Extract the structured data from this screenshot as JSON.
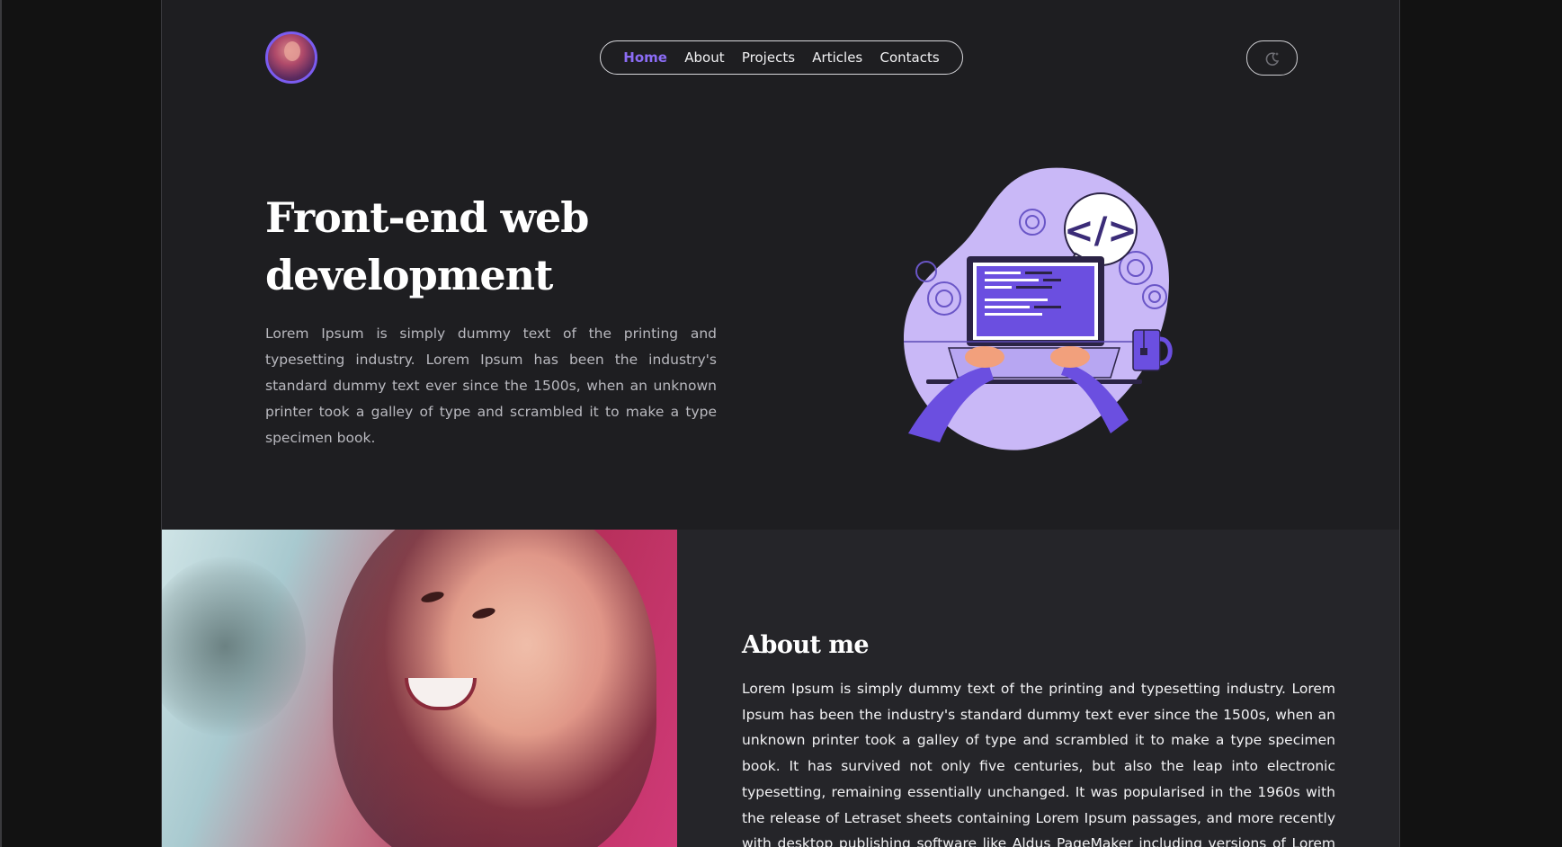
{
  "header": {
    "avatar_alt": "profile avatar",
    "nav": [
      {
        "label": "Home",
        "active": true
      },
      {
        "label": "About",
        "active": false
      },
      {
        "label": "Projects",
        "active": false
      },
      {
        "label": "Articles",
        "active": false
      },
      {
        "label": "Contacts",
        "active": false
      }
    ],
    "theme_toggle_icon": "moon-icon"
  },
  "hero": {
    "title_line1": "Front-end web",
    "title_line2": "development",
    "text": "Lorem Ipsum is simply dummy text of the printing and typesetting industry. Lorem Ipsum has been the industry's standard dummy text ever since the 1500s, when an unknown printer took a galley of type and scrambled it to make a type specimen book.",
    "illustration_icon": "developer-laptop-illustration"
  },
  "about": {
    "title": "About me",
    "text": "Lorem Ipsum is simply dummy text of the printing and typesetting industry. Lorem Ipsum has been the industry's standard dummy text ever since the 1500s, when an unknown printer took a galley of type and scrambled it to make a type specimen book. It has survived not only five centuries, but also the leap into electronic typesetting, remaining essentially unchanged. It was popularised in the 1960s with the release of Letraset sheets containing Lorem Ipsum passages, and more recently with desktop publishing software like Aldus PageMaker including versions of Lorem Ipsum."
  },
  "colors": {
    "accent": "#7b5cf0",
    "page_bg": "#1e1e21",
    "outer_bg": "#121212",
    "about_bg": "#252529"
  }
}
